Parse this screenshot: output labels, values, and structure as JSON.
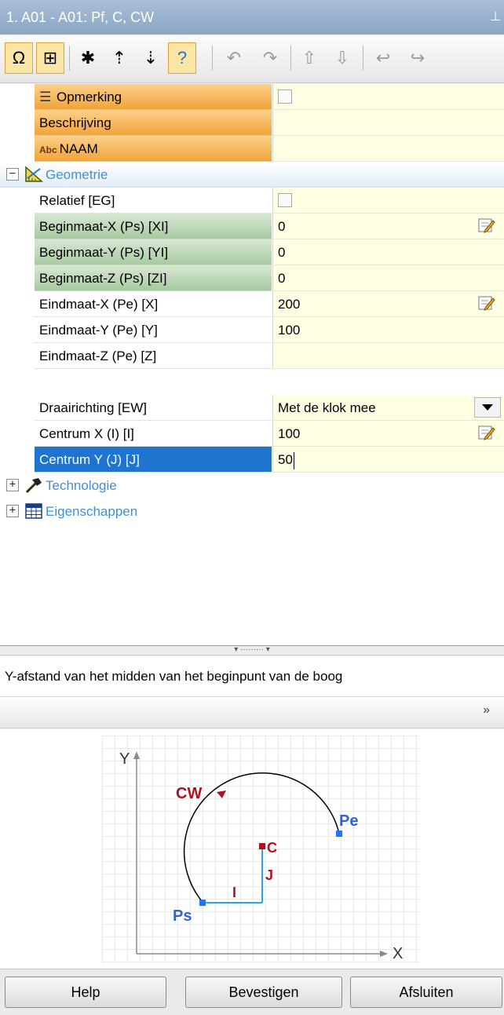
{
  "window": {
    "title": "1. A01 - A01: Pf, C, CW",
    "pin_icon": "pin-icon"
  },
  "toolbar": {
    "items": [
      {
        "icon": "omega-icon",
        "glyph": "Ω",
        "active": true
      },
      {
        "icon": "grid-table-icon",
        "glyph": "⊞",
        "active": true
      },
      {
        "icon": "new-item-icon",
        "glyph": "✱"
      },
      {
        "icon": "move-up-icon",
        "glyph": "⇡"
      },
      {
        "icon": "move-down-icon",
        "glyph": "⇣"
      },
      {
        "icon": "help-query-icon",
        "glyph": "?",
        "active": true
      },
      {
        "icon": "rotate-left-icon",
        "glyph": "↶",
        "dim": true
      },
      {
        "icon": "rotate-right-icon",
        "glyph": "↷",
        "dim": true
      },
      {
        "icon": "sort-up-icon",
        "glyph": "⇧",
        "dim": true
      },
      {
        "icon": "sort-down-icon",
        "glyph": "⇩",
        "dim": true
      },
      {
        "icon": "undo-icon",
        "glyph": "↩",
        "dim": true
      },
      {
        "icon": "redo-icon",
        "glyph": "↪",
        "dim": true
      }
    ]
  },
  "properties": {
    "top": [
      {
        "label": "Opmerking",
        "value": "",
        "style": "orange",
        "control": "checkbox",
        "icon": "comment-list-icon"
      },
      {
        "label": "Beschrijving",
        "value": "",
        "style": "orange"
      },
      {
        "label": "NAAM",
        "label_prefix": "Abc",
        "value": "",
        "style": "orange"
      }
    ],
    "geometry_group": {
      "label": "Geometrie",
      "expander": "−",
      "icon": "geometry-ruler-icon"
    },
    "geometry": [
      {
        "label": "Relatief [EG]",
        "value": "",
        "style": "plain",
        "control": "checkbox"
      },
      {
        "label": "Beginmaat-X (Ps) [XI]",
        "value": "0",
        "style": "green",
        "control": "edit"
      },
      {
        "label": "Beginmaat-Y (Ps) [YI]",
        "value": "0",
        "style": "green"
      },
      {
        "label": "Beginmaat-Z (Ps) [ZI]",
        "value": "0",
        "style": "green"
      },
      {
        "label": "Eindmaat-X (Pe) [X]",
        "value": "200",
        "style": "plain",
        "control": "edit"
      },
      {
        "label": "Eindmaat-Y (Pe) [Y]",
        "value": "100",
        "style": "plain"
      },
      {
        "label": "Eindmaat-Z (Pe) [Z]",
        "value": "",
        "style": "plain"
      },
      {
        "label": "Draairichting [EW]",
        "value": "Met de klok mee",
        "style": "plain",
        "control": "dropdown",
        "gap_before": true
      },
      {
        "label": "Centrum X (I) [I]",
        "value": "100",
        "style": "plain",
        "control": "edit"
      },
      {
        "label": "Centrum Y (J) [J]",
        "value": "50",
        "style": "selected",
        "control": "text-cursor"
      }
    ],
    "groups_collapsed": [
      {
        "label": "Technologie",
        "expander": "+",
        "icon": "hammer-icon"
      },
      {
        "label": "Eigenschappen",
        "expander": "+",
        "icon": "properties-table-icon"
      }
    ]
  },
  "description": "Y-afstand van het midden van het beginpunt van de boog",
  "diagram": {
    "axis_x": "X",
    "axis_y": "Y",
    "labels": {
      "cw": "CW",
      "pe": "Pe",
      "ps": "Ps",
      "c": "C",
      "i": "I",
      "j": "J"
    },
    "colors": {
      "arc": "#000000",
      "points": "#1e78ff",
      "center": "#b01020",
      "dim_lines": "#2aa8e0",
      "pe_ps_text": "#3060e0",
      "cw_text": "#b01020"
    }
  },
  "buttons": {
    "help": "Help",
    "confirm": "Bevestigen",
    "close": "Afsluiten"
  }
}
